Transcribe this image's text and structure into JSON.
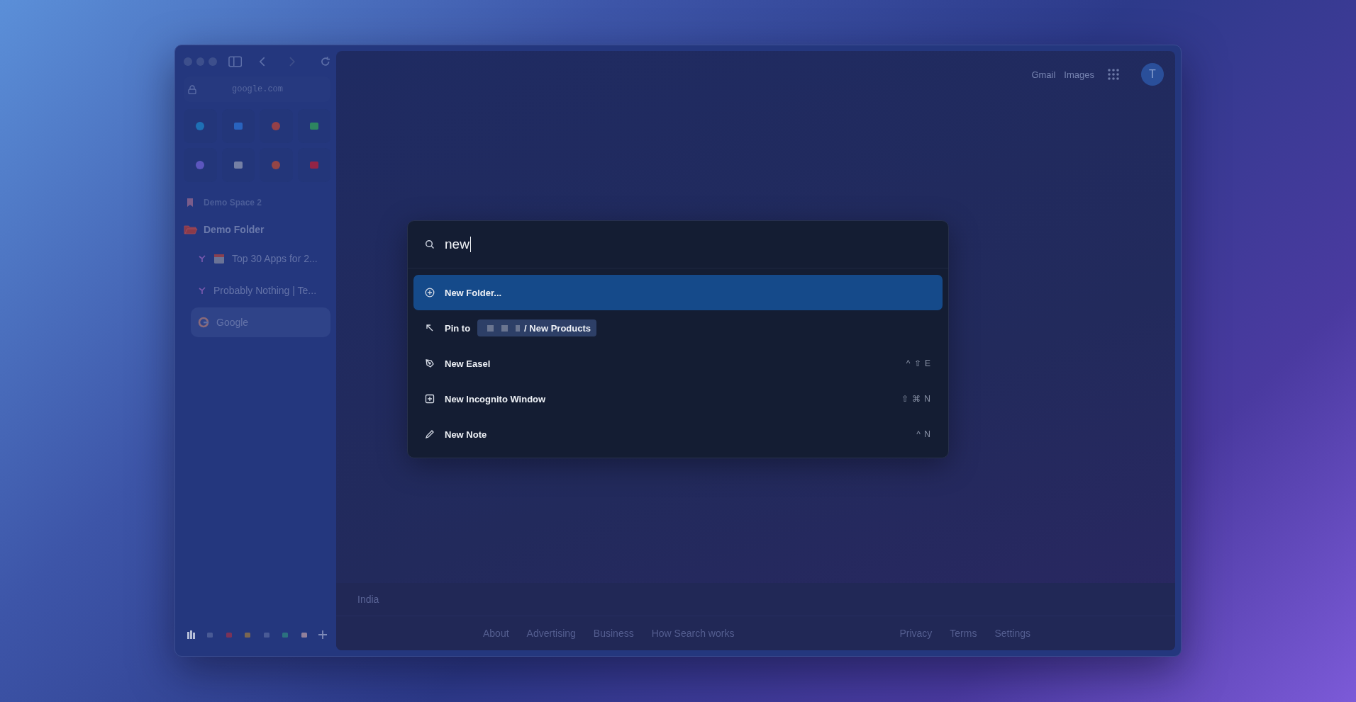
{
  "sidebar": {
    "url": "google.com",
    "space": {
      "label": "Demo Space 2"
    },
    "folder": {
      "label": "Demo Folder",
      "expanded": true,
      "children": [
        {
          "label": "Top 30 Apps for 2...",
          "selected": false
        },
        {
          "label": "Probably Nothing | Te...",
          "selected": false
        },
        {
          "label": "Google",
          "selected": true
        }
      ]
    }
  },
  "header": {
    "links": [
      "Gmail",
      "Images"
    ],
    "avatar": "T"
  },
  "palette": {
    "query": "new",
    "items": [
      {
        "kind": "action",
        "label": "New Folder...",
        "selected": true
      },
      {
        "kind": "pin",
        "label": "Pin to",
        "target": "/ New Products",
        "selected": false
      },
      {
        "kind": "action",
        "label": "New Easel",
        "shortcut": "^ ⇧ E",
        "selected": false
      },
      {
        "kind": "action",
        "label": "New Incognito Window",
        "shortcut": "⇧ ⌘ N",
        "selected": false
      },
      {
        "kind": "action",
        "label": "New Note",
        "shortcut": "^ N",
        "selected": false
      }
    ]
  },
  "footer": {
    "country": "India",
    "left_links": [
      "About",
      "Advertising",
      "Business",
      "How Search works"
    ],
    "right_links": [
      "Privacy",
      "Terms",
      "Settings"
    ]
  }
}
